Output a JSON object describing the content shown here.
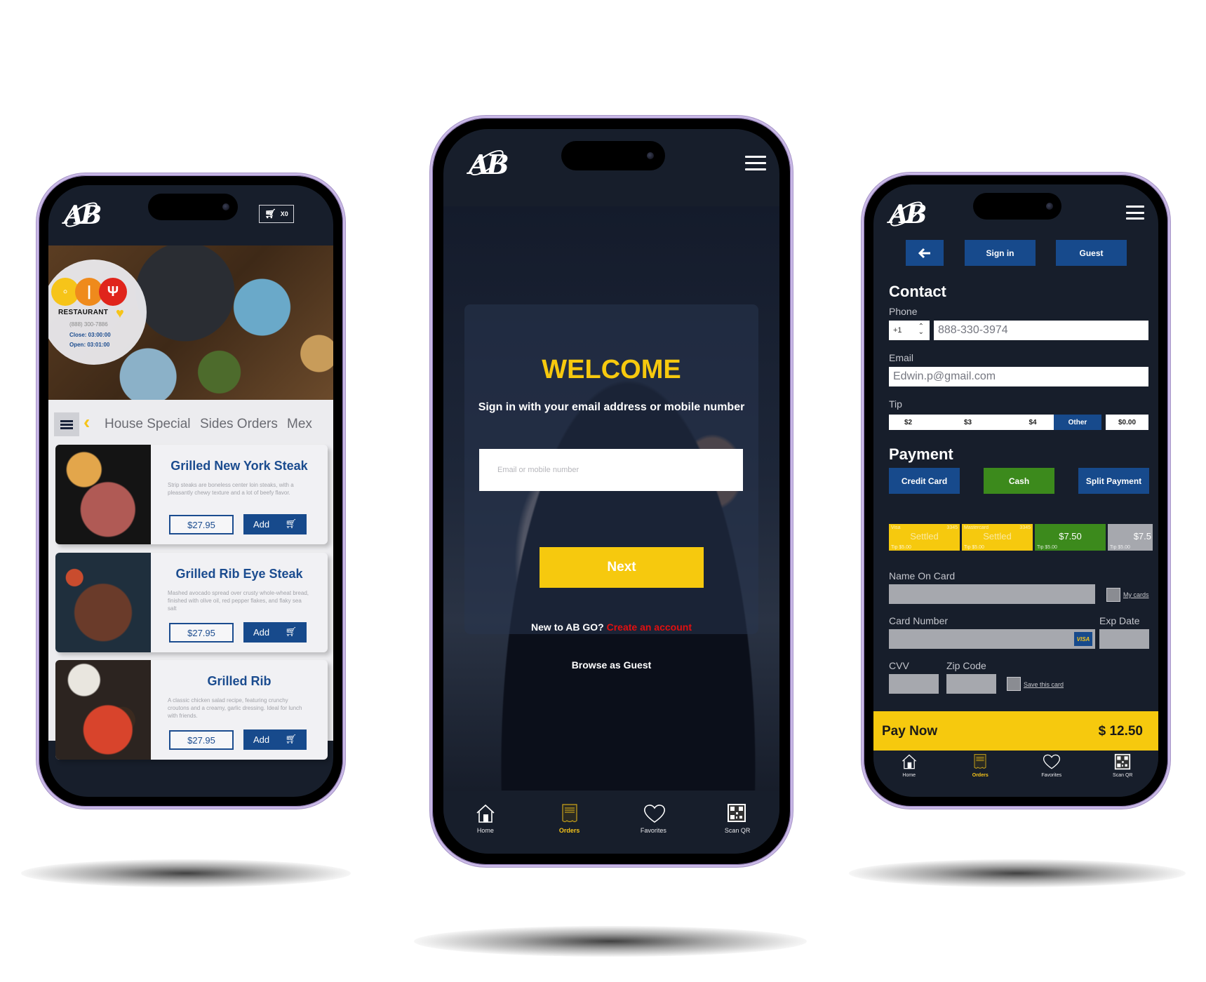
{
  "brand": {
    "logo_text": "AB"
  },
  "colors": {
    "navy": "#171e2b",
    "blue": "#174a8c",
    "yellow": "#f6c90e",
    "green": "#3c8a1c",
    "red": "#e11010",
    "gray_field": "#a6a8ae"
  },
  "menu_screen": {
    "cart": {
      "icon": "cart-icon",
      "count": "X0"
    },
    "restaurant": {
      "name": "RESTAURANT",
      "phone": "(888) 300-7886",
      "close": "Close: 03:00:00",
      "open": "Open: 03:01:00"
    },
    "tabs": [
      "House Special",
      "Sides Orders",
      "Mex"
    ],
    "items": [
      {
        "title": "Grilled New York Steak",
        "description": "Strip steaks are boneless center loin steaks, with a pleasantly chewy texture and a lot of beefy flavor.",
        "price": "$27.95",
        "add_label": "Add"
      },
      {
        "title": "Grilled Rib Eye Steak",
        "description": "Mashed avocado spread over crusty whole-wheat bread, finished with olive oil, red pepper flakes, and flaky sea salt",
        "price": "$27.95",
        "add_label": "Add"
      },
      {
        "title": "Grilled Rib",
        "description": "A classic chicken salad recipe, featuring crunchy croutons and a creamy, garlic dressing. Ideal for lunch with friends.",
        "price": "$27.95",
        "add_label": "Add"
      }
    ]
  },
  "login_screen": {
    "title": "WELCOME",
    "subtitle": "Sign in with your email address or mobile number",
    "input_placeholder": "Email or mobile number",
    "input_value": "",
    "next_label": "Next",
    "new_prompt": "New to AB GO?",
    "create_account": "Create an account",
    "browse_guest": "Browse as Guest"
  },
  "nav": [
    {
      "label": "Home",
      "icon": "home-icon",
      "active": false
    },
    {
      "label": "Orders",
      "icon": "receipt-icon",
      "active": true
    },
    {
      "label": "Favorites",
      "icon": "heart-icon",
      "active": false
    },
    {
      "label": "Scan QR",
      "icon": "qr-code-icon",
      "active": false
    }
  ],
  "checkout_screen": {
    "back_icon": "arrow-left-icon",
    "sign_in_label": "Sign in",
    "guest_label": "Guest",
    "contact_title": "Contact",
    "phone_label": "Phone",
    "country_code": "+1",
    "phone_value": "888-330-3974",
    "email_label": "Email",
    "email_value": "Edwin.p@gmail.com",
    "tip_label": "Tip",
    "tip_options": [
      "$2",
      "$3",
      "$4",
      "Other"
    ],
    "tip_selected": "Other",
    "tip_custom_value": "$0.00",
    "payment_title": "Payment",
    "payment_methods": [
      "Credit Card",
      "Cash",
      "Split Payment"
    ],
    "splits": [
      {
        "brand": "Visa",
        "last4": "3345",
        "status": "Settled",
        "tip": "Tip $5.00",
        "color": "#f6c90e"
      },
      {
        "brand": "Mastercard",
        "last4": "3345",
        "status": "Settled",
        "tip": "Tip $5.00",
        "color": "#f6c90e"
      },
      {
        "brand": "",
        "last4": "",
        "status": "$7.50",
        "tip": "Tip $5.00",
        "color": "#3c8a1c"
      },
      {
        "brand": "",
        "last4": "",
        "status": "$7.5",
        "tip": "Tip $5.00",
        "color": "#a6a8ae"
      }
    ],
    "name_on_card_label": "Name On Card",
    "my_cards_label": "My cards",
    "card_number_label": "Card Number",
    "card_brand_badge": "VISA",
    "exp_date_label": "Exp Date",
    "cvv_label": "CVV",
    "zip_label": "Zip Code",
    "save_card_label": "Save this card",
    "pay_now_label": "Pay Now",
    "total": "$ 12.50"
  }
}
